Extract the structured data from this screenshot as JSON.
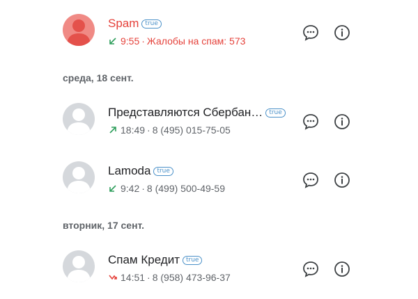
{
  "badge_text": "true",
  "sections": [
    {
      "label": "среда, 18 сент."
    },
    {
      "label": "вторник, 17 сент."
    }
  ],
  "calls": [
    {
      "name": "Spam",
      "time": "9:55",
      "detail": "Жалобы на спам: 573",
      "direction": "incoming",
      "highlight": "spam"
    },
    {
      "name": "Представляются Сбербан…",
      "time": "18:49",
      "detail": "8 (495) 015-75-05",
      "direction": "outgoing"
    },
    {
      "name": "Lamoda",
      "time": "9:42",
      "detail": "8 (499) 500-49-59",
      "direction": "incoming"
    },
    {
      "name": "Спам Кредит",
      "time": "14:51",
      "detail": "8 (958) 473-96-37",
      "direction": "missed"
    }
  ],
  "colors": {
    "spam": "#e5413a",
    "incoming": "#2e9e5b",
    "outgoing": "#2e9e5b",
    "missed": "#e5413a"
  }
}
